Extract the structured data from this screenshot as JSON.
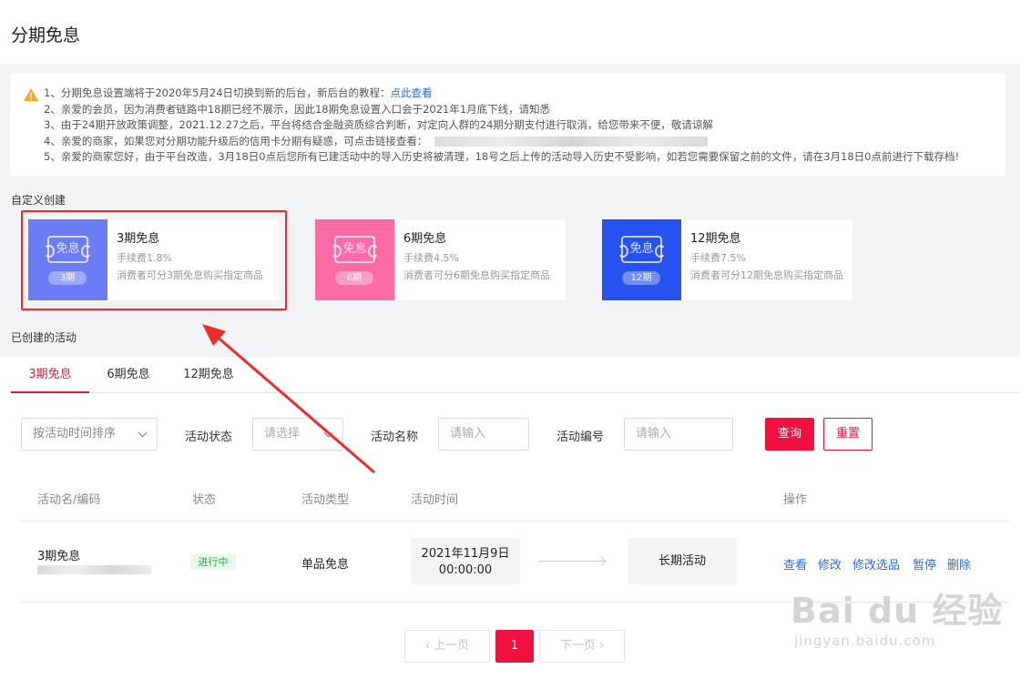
{
  "page": {
    "title": "分期免息"
  },
  "notice": {
    "lines": [
      "1、分期免息设置端将于2020年5月24日切换到新的后台，新后台的教程：",
      "2、亲爱的会员，因为消费者链路中18期已经不展示，因此18期免息设置入口会于2021年1月底下线，请知悉",
      "3、由于24期开放政策调整，2021.12.27之后，平台将结合金融资质综合判断，对定向人群的24期分期支付进行取消，给您带来不便，敬请谅解",
      "4、亲爱的商家，如果您对分期功能升级后的信用卡分期有疑惑，可点击链接查看：",
      "5、亲爱的商家您好，由于平台改造，3月18日0点后您所有已建活动中的导入历史将被清理，18号之后上传的活动导入历史不受影响，如若您需要保留之前的文件，请在3月18日0点前进行下载存档!"
    ],
    "link_label": "点此查看"
  },
  "custom_create": {
    "label": "自定义创建",
    "cards": [
      {
        "icon_text": "免息",
        "badge": "3期",
        "name": "3期免息",
        "fee": "手续费1.8%",
        "desc": "消费者可分3期免息购买指定商品",
        "color": "#6b7cf6"
      },
      {
        "icon_text": "免息",
        "badge": "6期",
        "name": "6期免息",
        "fee": "手续费4.5%",
        "desc": "消费者可分6期免息购买指定商品",
        "color": "#fb6ba5"
      },
      {
        "icon_text": "免息",
        "badge": "12期",
        "name": "12期免息",
        "fee": "手续费7.5%",
        "desc": "消费者可分12期免息购买指定商品",
        "color": "#2652ef"
      }
    ]
  },
  "created": {
    "label": "已创建的活动",
    "tabs": [
      "3期免息",
      "6期免息",
      "12期免息"
    ]
  },
  "filters": {
    "sort_select": "按活动时间排序",
    "status_label": "活动状态",
    "status_placeholder": "请选择",
    "name_label": "活动名称",
    "name_placeholder": "请输入",
    "code_label": "活动编号",
    "code_placeholder": "请输入",
    "query_button": "查询",
    "reset_button": "重置"
  },
  "table": {
    "headers": [
      "活动名/编码",
      "状态",
      "活动类型",
      "活动时间",
      "操作"
    ],
    "row": {
      "name": "3期免息",
      "status": "进行中",
      "type": "单品免息",
      "start_date": "2021年11月9日",
      "start_time": "00:00:00",
      "end": "长期活动",
      "actions": [
        "查看",
        "修改",
        "修改选品",
        "暂停",
        "删除"
      ]
    }
  },
  "pagination": {
    "prev": "上一页",
    "current": "1",
    "next": "下一页"
  },
  "watermark": {
    "main": "Bai du 经验",
    "sub": "jingyan.baidu.com"
  },
  "colors": {
    "accent": "#f0113e",
    "link": "#2f6bdc",
    "highlight": "#f02b2b",
    "status_green": "#2aa745"
  },
  "icons": [
    "warning-icon",
    "ticket-icon",
    "chevron-down-icon",
    "chevron-left-icon",
    "chevron-right-icon",
    "annotation-arrow-icon"
  ]
}
